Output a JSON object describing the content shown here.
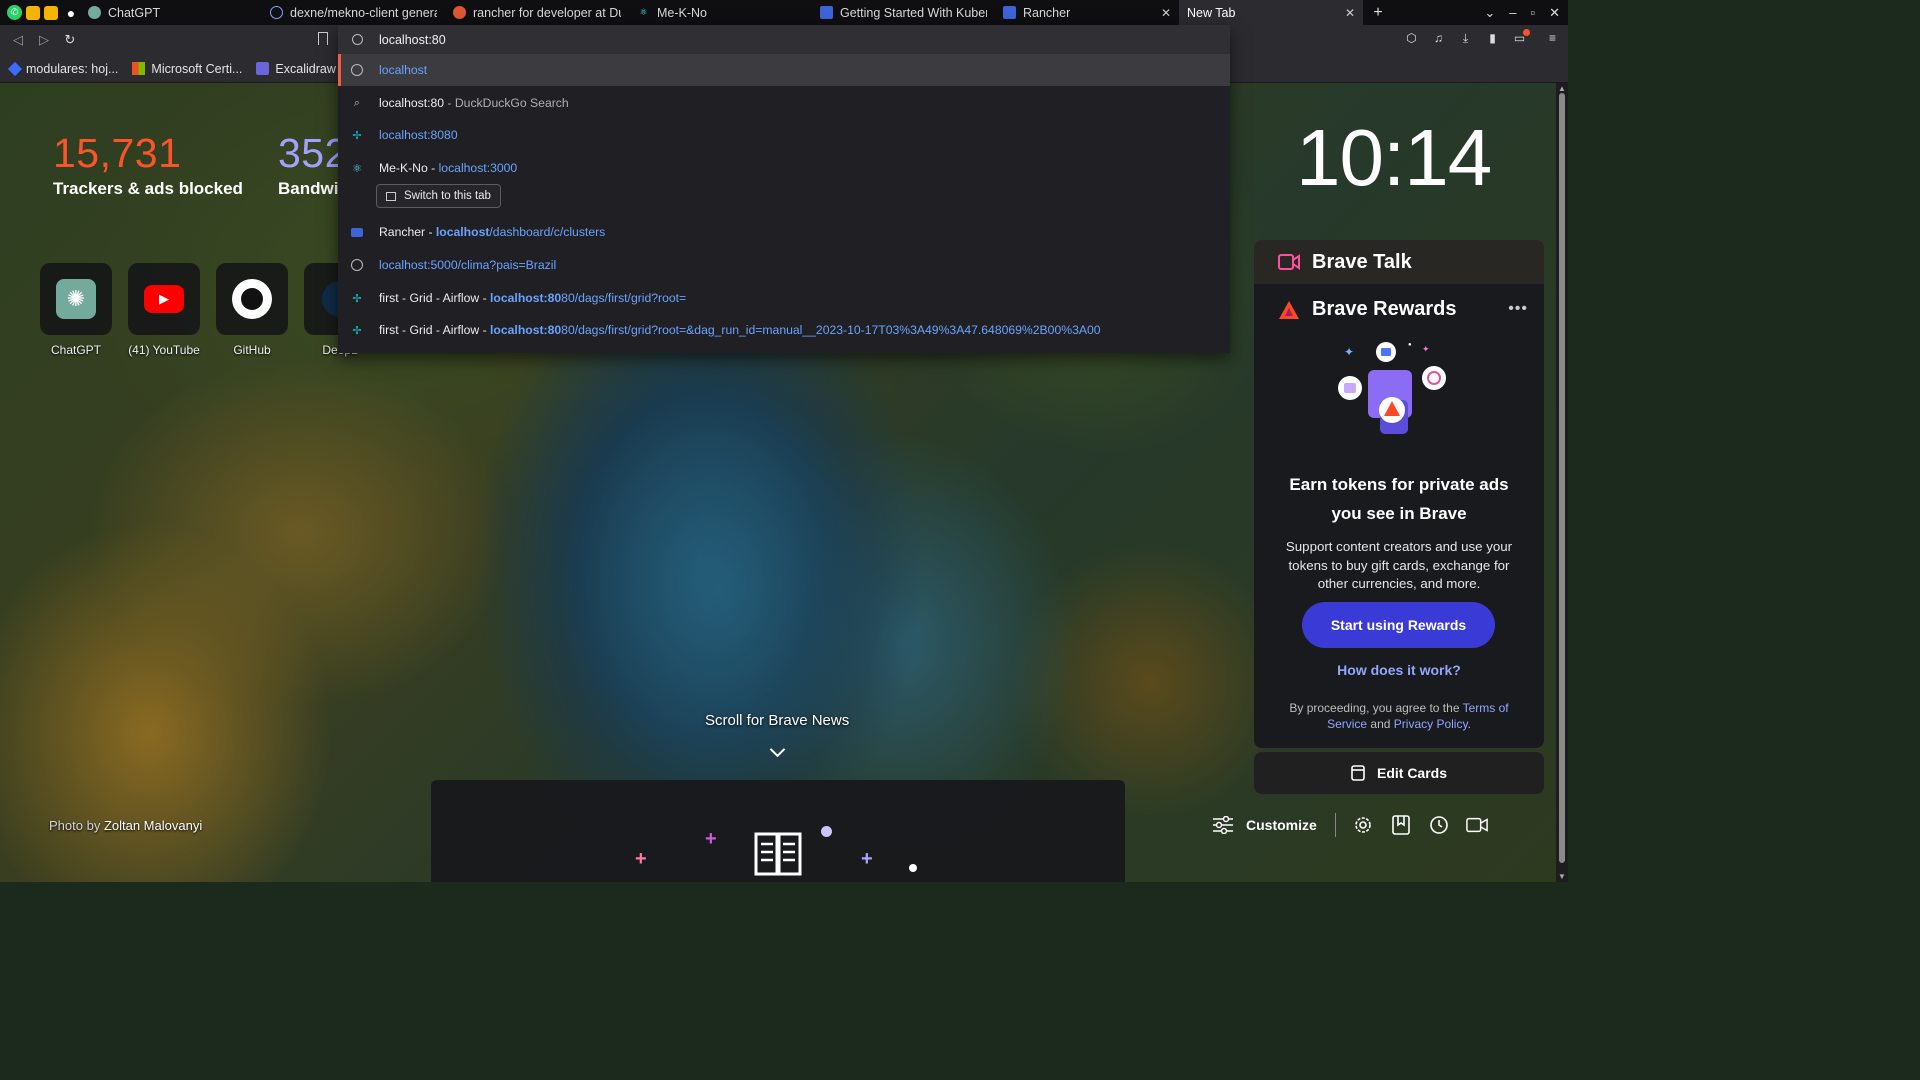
{
  "tabs": [
    {
      "title": "ChatGPT"
    },
    {
      "title": "dexne/mekno-client general"
    },
    {
      "title": "rancher for developer at Duc"
    },
    {
      "title": "Me-K-No"
    },
    {
      "title": "Getting Started With Kubern"
    },
    {
      "title": "Rancher"
    },
    {
      "title": "New Tab"
    }
  ],
  "bookmarks": [
    {
      "label": "modulares: hoj..."
    },
    {
      "label": "Microsoft Certi..."
    },
    {
      "label": "Excalidraw"
    }
  ],
  "omnibox": {
    "input_value": "localhost:80",
    "suggestions": [
      {
        "main": "localhost",
        "suffix": ""
      },
      {
        "main": "localhost:80",
        "suffix": " - DuckDuckGo Search"
      },
      {
        "main": "localhost:8080",
        "suffix": ""
      },
      {
        "main": "Me-K-No - ",
        "url": "localhost:3000"
      },
      {
        "main": "Rancher - ",
        "url_bold": "localhost",
        "url": "/dashboard/c/clusters"
      },
      {
        "main": "localhost:5000/clima?pais=Brazil"
      },
      {
        "main": "first - Grid - Airflow - ",
        "url_bold": "localhost:80",
        "url": "80/dags/first/grid?root="
      },
      {
        "main": "first - Grid - Airflow - ",
        "url_bold": "localhost:80",
        "url": "80/dags/first/grid?root=&dag_run_id=manual__2023-10-17T03%3A49%3A47.648069%2B00%3A00"
      }
    ],
    "switch_tab_label": "Switch to this tab"
  },
  "stats": {
    "trackers_value": "15,731",
    "trackers_label": "Trackers & ads blocked",
    "bandwidth_value": "352",
    "bandwidth_label": "Bandwi"
  },
  "top_sites": [
    {
      "name": "ChatGPT"
    },
    {
      "name": "(41) YouTube"
    },
    {
      "name": "GitHub"
    },
    {
      "name": "DeepL"
    }
  ],
  "clock": "10:14",
  "brave_talk": {
    "title": "Brave Talk"
  },
  "brave_rewards": {
    "title": "Brave Rewards",
    "more": "•••",
    "headline": "Earn tokens for private ads you see in Brave",
    "description": "Support content creators and use your tokens to buy gift cards, exchange for other currencies, and more.",
    "cta": "Start using Rewards",
    "how": "How does it work?",
    "legal_prefix": "By proceeding, you agree to the ",
    "legal_terms": "Terms of Service",
    "legal_and": " and ",
    "legal_privacy": "Privacy Policy",
    "legal_end": "."
  },
  "edit_cards": "Edit Cards",
  "scroll_news": "Scroll for Brave News",
  "photo_credit": {
    "prefix": "Photo by ",
    "author": "Zoltan Malovanyi"
  },
  "customize": "Customize",
  "colors": {
    "accent_orange": "#fb542b",
    "bandwidth_purple": "#a3a1ff",
    "link_blue": "#6aa2ff",
    "rewards_button": "#3a3ad6"
  }
}
